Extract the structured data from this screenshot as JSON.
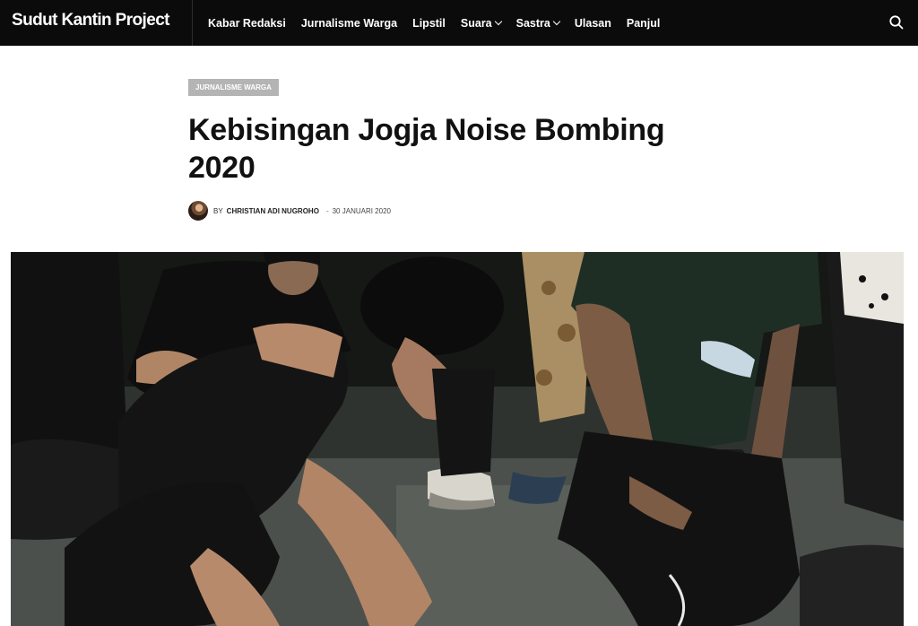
{
  "site": {
    "logo": "Sudut Kantin Project"
  },
  "nav": {
    "items": [
      {
        "label": "Kabar Redaksi",
        "dropdown": false
      },
      {
        "label": "Jurnalisme Warga",
        "dropdown": false
      },
      {
        "label": "Lipstil",
        "dropdown": false
      },
      {
        "label": "Suara",
        "dropdown": true
      },
      {
        "label": "Sastra",
        "dropdown": true
      },
      {
        "label": "Ulasan",
        "dropdown": false
      },
      {
        "label": "Panjul",
        "dropdown": false
      }
    ],
    "search_icon": "search-icon"
  },
  "article": {
    "category": "JURNALISME WARGA",
    "title": "Kebisingan Jogja Noise Bombing 2020",
    "by_prefix": "BY",
    "author": "CHRISTIAN ADI NUGROHO",
    "separator": "-",
    "date": "30 JANUARI 2020"
  },
  "colors": {
    "topbar": "#0b0b0b",
    "badge": "#b4b4b4",
    "title": "#111111"
  }
}
